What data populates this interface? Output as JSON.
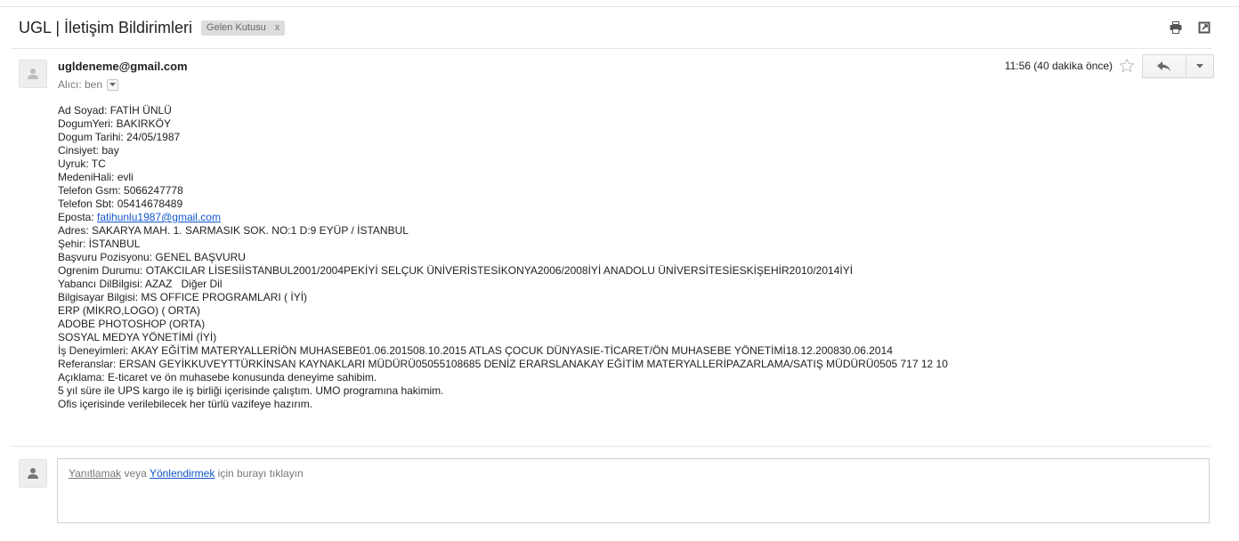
{
  "header": {
    "subject": "UGL | İletişim Bildirimleri",
    "label": "Gelen Kutusu",
    "label_remove": "x",
    "icons": [
      "print-icon",
      "open-new-window-icon"
    ]
  },
  "message": {
    "sender": "ugldeneme@gmail.com",
    "recipient_label": "Alıcı: ben",
    "time": "11:56 (40 dakika önce)",
    "icons": [
      "avatar-icon",
      "star-icon",
      "reply-icon",
      "chevron-down-icon"
    ],
    "body": {
      "l0": "Ad Soyad: FATİH ÜNLÜ",
      "l1": "DogumYeri: BAKIRKÖY",
      "l2": "Dogum Tarihi: 24/05/1987",
      "l3": "Cinsiyet: bay",
      "l4": "Uyruk: TC",
      "l5": "MedeniHali: evli",
      "l6": "Telefon Gsm: 5066247778",
      "l7": "Telefon Sbt: 05414678489",
      "l8_label": "Eposta: ",
      "l8_link": "fatihunlu1987@gmail.com",
      "l9": "Adres: SAKARYA MAH. 1. SARMASIK SOK. NO:1 D:9 EYÜP / İSTANBUL",
      "l10": "Şehir: İSTANBUL",
      "l11": "Başvuru Pozisyonu: GENEL BAŞVURU",
      "l12": "Ogrenim Durumu: OTAKCILAR LİSESİİSTANBUL2001/2004PEKİYİ SELÇUK ÜNİVERİSTESİKONYA2006/2008İYİ ANADOLU ÜNİVERSİTESİESKİŞEHİR2010/2014İYİ",
      "l13": "Yabancı DilBilgisi: AZAZ   Diğer Dil",
      "l14": "Bilgisayar Bilgisi: MS OFFICE PROGRAMLARI ( İYİ)",
      "l15": "ERP (MİKRO,LOGO) ( ORTA)",
      "l16": "ADOBE PHOTOSHOP (ORTA)",
      "l17": "SOSYAL MEDYA YÖNETİMİ (İYİ)",
      "l18": "İş Deneyimleri: AKAY EĞİTİM MATERYALLERİÖN MUHASEBE01.06.201508.10.2015 ATLAS ÇOCUK DÜNYASIE-TİCARET/ÖN MUHASEBE YÖNETİMİ18.12.200830.06.2014",
      "l19": "Referanslar: ERSAN GEYİKKUVEYTTÜRKİNSAN KAYNAKLARI MÜDÜRÜ05055108685 DENİZ ERARSLANAKAY EĞİTİM MATERYALLERİPAZARLAMA/SATIŞ MÜDÜRÜ0505 717 12 10",
      "l20": "Açıklama: E-ticaret ve ön muhasebe konusunda deneyime sahibim.",
      "l21": "5 yıl süre ile UPS kargo ile iş birliği içerisinde çalıştım. UMO programına hakimim.",
      "l22": "Ofis içerisinde verilebilecek her türlü vazifeye hazırım."
    }
  },
  "reply_box": {
    "reply_link": "Yanıtlamak",
    "connector": " veya ",
    "forward_link": "Yönlendirmek",
    "suffix": " için burayı tıklayın"
  }
}
